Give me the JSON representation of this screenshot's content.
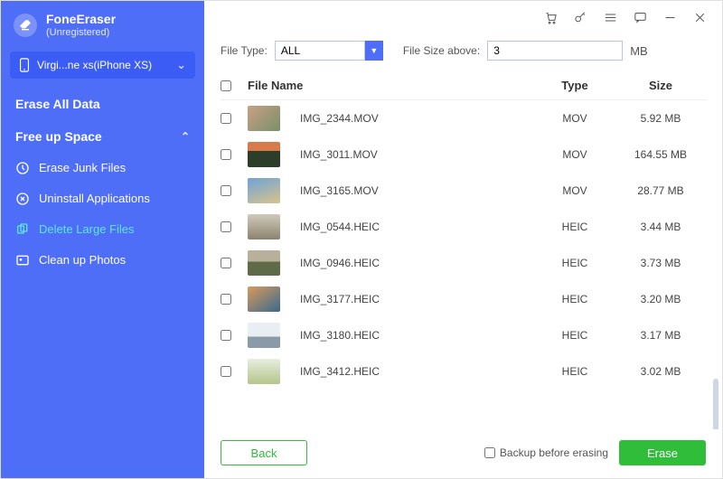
{
  "brand": {
    "title": "FoneEraser",
    "subtitle": "(Unregistered)"
  },
  "device": {
    "name": "Virgi...ne xs(iPhone XS)"
  },
  "sections": {
    "erase_all": "Erase All Data",
    "free_up": "Free up Space"
  },
  "menu": {
    "junk": "Erase Junk Files",
    "uninstall": "Uninstall Applications",
    "large": "Delete Large Files",
    "photos": "Clean up Photos"
  },
  "filter": {
    "filetype_label": "File Type:",
    "filetype_value": "ALL",
    "filesize_label": "File Size above:",
    "filesize_value": "3",
    "unit": "MB"
  },
  "columns": {
    "name": "File Name",
    "type": "Type",
    "size": "Size"
  },
  "rows": [
    {
      "name": "IMG_2344.MOV",
      "type": "MOV",
      "size": "5.92 MB",
      "thumb": "a"
    },
    {
      "name": "IMG_3011.MOV",
      "type": "MOV",
      "size": "164.55 MB",
      "thumb": "b"
    },
    {
      "name": "IMG_3165.MOV",
      "type": "MOV",
      "size": "28.77 MB",
      "thumb": "c"
    },
    {
      "name": "IMG_0544.HEIC",
      "type": "HEIC",
      "size": "3.44 MB",
      "thumb": "d"
    },
    {
      "name": "IMG_0946.HEIC",
      "type": "HEIC",
      "size": "3.73 MB",
      "thumb": "e"
    },
    {
      "name": "IMG_3177.HEIC",
      "type": "HEIC",
      "size": "3.20 MB",
      "thumb": "f"
    },
    {
      "name": "IMG_3180.HEIC",
      "type": "HEIC",
      "size": "3.17 MB",
      "thumb": "g"
    },
    {
      "name": "IMG_3412.HEIC",
      "type": "HEIC",
      "size": "3.02 MB",
      "thumb": "h"
    }
  ],
  "footer": {
    "back": "Back",
    "backup": "Backup before erasing",
    "erase": "Erase"
  }
}
